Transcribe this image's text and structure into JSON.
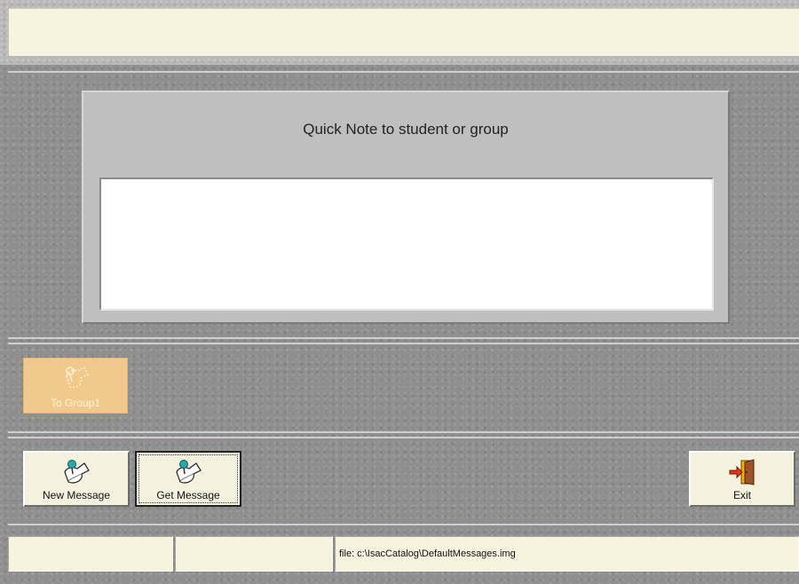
{
  "note_panel": {
    "title": "Quick Note to student or group",
    "text_value": ""
  },
  "group_panel": {
    "to_group_label": "To Group1",
    "to_group_icon": "group-pin-icon",
    "to_group_disabled": true
  },
  "buttons": {
    "new_message_label": "New Message",
    "new_message_icon": "pinned-note-icon",
    "get_message_label": "Get Message",
    "get_message_icon": "pinned-note-icon",
    "exit_label": "Exit",
    "exit_icon": "exit-door-icon"
  },
  "status_bar": {
    "cell1": "",
    "cell2": "",
    "file_path": "file: c:\\IsacCatalog\\DefaultMessages.img"
  },
  "colors": {
    "panel_cream": "#f6f3de",
    "to_group_orange": "#f1c98a",
    "background_gray": "#8f8f8f"
  }
}
